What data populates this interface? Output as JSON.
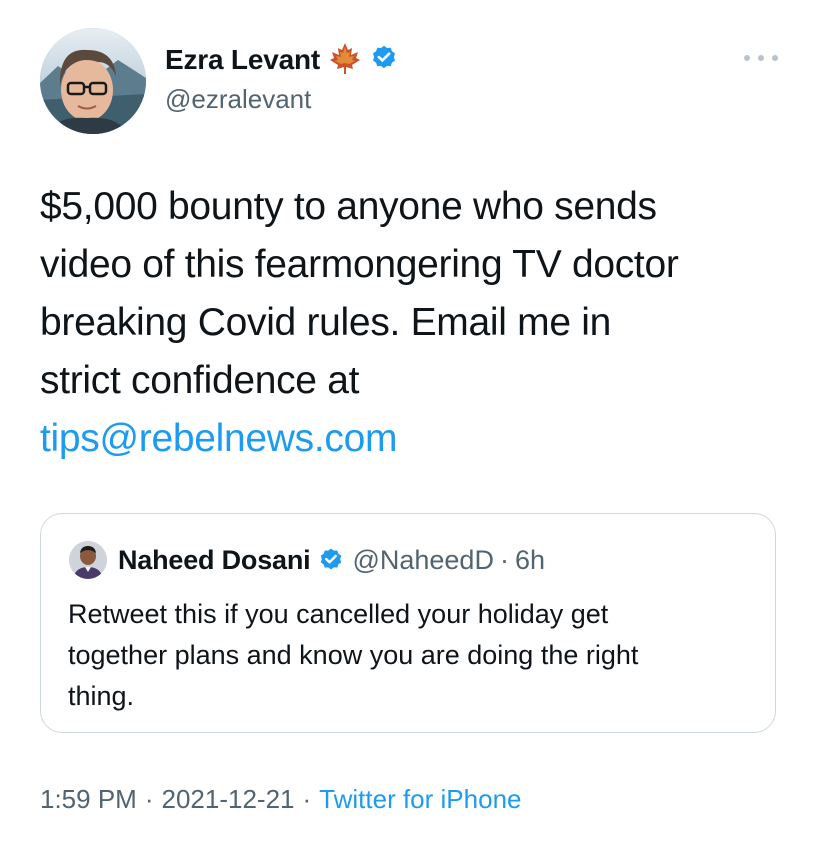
{
  "author": {
    "display_name": "Ezra Levant",
    "handle": "@ezralevant",
    "emoji_icon": "maple-leaf-icon",
    "verified_icon": "verified-badge-icon"
  },
  "tweet": {
    "lines": [
      "$5,000 bounty to anyone who sends",
      "video of this fearmongering TV doctor",
      "breaking Covid rules. Email me in",
      "strict confidence at"
    ],
    "link": "tips@rebelnews.com"
  },
  "quoted": {
    "display_name": "Naheed Dosani",
    "handle": "@NaheedD",
    "separator": "·",
    "time": "6h",
    "lines": [
      "Retweet this if you cancelled your holiday get",
      "together plans and know you are doing the right",
      "thing."
    ]
  },
  "meta": {
    "time": "1:59 PM",
    "separator": "·",
    "date": "2021-12-21",
    "source": "Twitter for iPhone"
  },
  "colors": {
    "link": "#1d9bf0",
    "secondary_text": "#536471",
    "verified": "#1d9bf0",
    "border": "#cfd9de"
  }
}
